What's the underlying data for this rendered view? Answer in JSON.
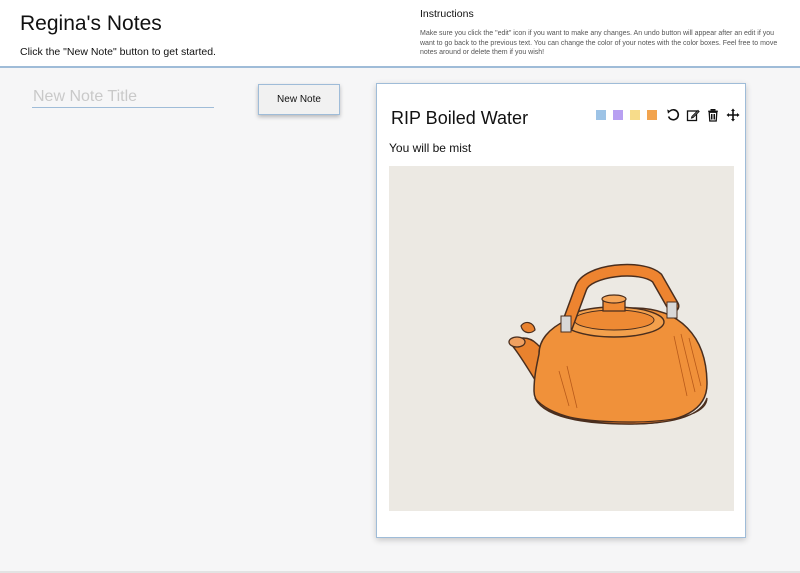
{
  "header": {
    "title": "Regina's Notes",
    "subtitle": "Click the \"New Note\" button to get started.",
    "instructions_title": "Instructions",
    "instructions_text": "Make sure you click the \"edit\" icon if you want to make any changes. An undo button will appear after an edit if you want to go back to the previous text. You can change the color of your notes with the color boxes. Feel free to move notes around or delete them if you wish!"
  },
  "form": {
    "title_placeholder": "New Note Title",
    "title_value": "",
    "new_note_label": "New Note"
  },
  "note": {
    "title": "RIP Boiled Water",
    "body": "You will be mist",
    "swatches": [
      {
        "name": "blue",
        "color": "#9dc3e6"
      },
      {
        "name": "purple",
        "color": "#b8a0f2"
      },
      {
        "name": "yellow",
        "color": "#f7dc8a"
      },
      {
        "name": "orange",
        "color": "#f2a44f"
      }
    ],
    "tools": [
      "undo-icon",
      "edit-icon",
      "trash-icon",
      "move-icon"
    ],
    "image": "orange-kettle-drawing"
  },
  "colors": {
    "accent": "#9fbcd8",
    "background": "#f6f6f7"
  }
}
